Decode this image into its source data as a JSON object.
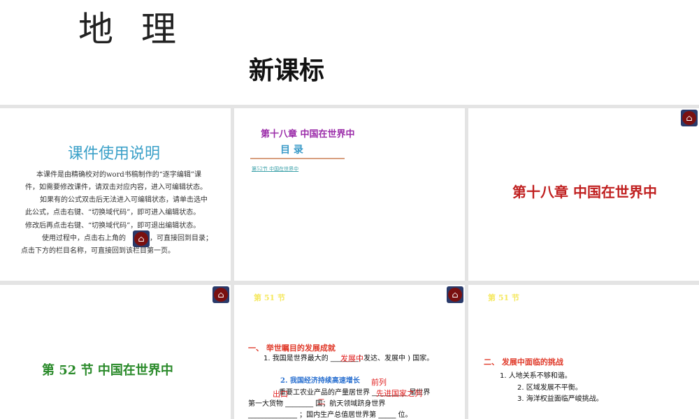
{
  "header": {
    "subject": "地理",
    "standard": "新课标"
  },
  "slide1": {
    "title": "课件使用说明",
    "lines": [
      "本课件是由精确校对的word书稿制作的“逐字编辑”课",
      "件，如需要修改课件，请双击对应内容，进入可编辑状态。",
      "如果有的公式双击后无法进入可编辑状态，请单击选中",
      "此公式，点击右键、“切换域代码”，即可进入编辑状态。",
      "修改后再点击右键、“切换域代码”，即可退出编辑状态。",
      "使用过程中，点击右上角的",
      "，可直接回到目录；",
      "点击下方的栏目名称，可直接回到该栏目第一页。"
    ]
  },
  "slide2": {
    "chapter": "第十八章  中国在世界中",
    "toc": "目  录",
    "link": "第52节   中国在世界中"
  },
  "slide3": {
    "title": "第十八章   中国在世界中"
  },
  "slide4": {
    "title": "第 52 节    中国在世界中"
  },
  "slide5": {
    "section": "第 51 节",
    "heading": "一、  举世瞩目的发展成就",
    "q1": "1. 我国是世界最大的 ________( 发达、发展中 ) 国家。",
    "a1": "发展中",
    "sub2": "2. 我国经济持续高速增长",
    "q2a": "重要工农业产品的产量居世界 __________ 是世界",
    "q2b": "第一大货物 ________ 国；航天领域跻身世界",
    "q2c": "______________ ；国内生产总值居世界第 _____ 位。",
    "a2a": "前列",
    "a2b": "出口",
    "a2c": "先进国家之列",
    "a2d": "二"
  },
  "slide6": {
    "section": "第 51 节",
    "heading": "二、  发展中面临的挑战",
    "items": [
      "1. 人地关系不够和谐。",
      "2. 区域发展不平衡。",
      "3. 海洋权益面临严峻挑战。"
    ]
  }
}
